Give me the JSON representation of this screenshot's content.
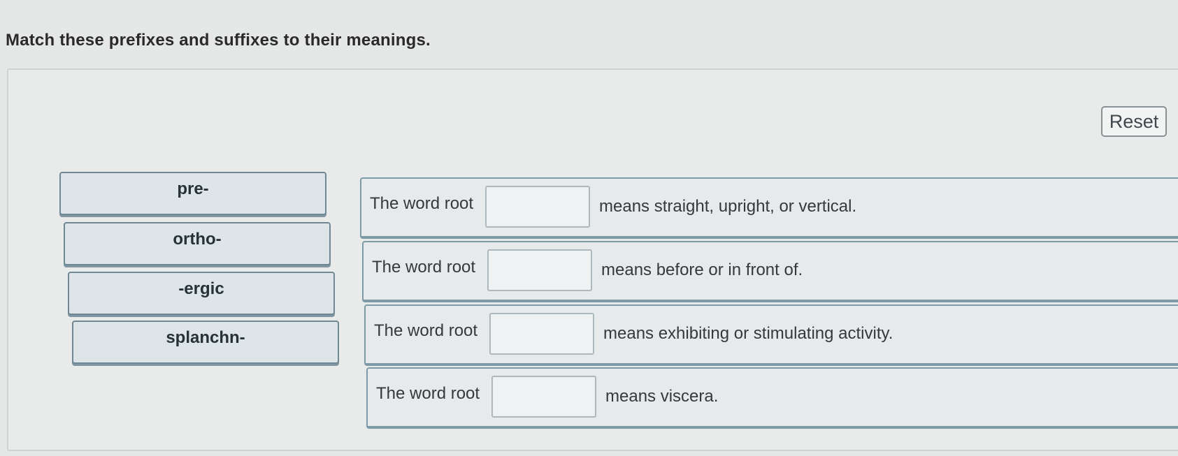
{
  "question": {
    "title": "Match these prefixes and suffixes to their meanings."
  },
  "reset_label": "Reset",
  "tiles": [
    {
      "label": "pre-"
    },
    {
      "label": "ortho-"
    },
    {
      "label": "-ergic"
    },
    {
      "label": "splanchn-"
    }
  ],
  "rows": [
    {
      "prefix_label": "The word root",
      "meaning": "means straight, upright, or vertical."
    },
    {
      "prefix_label": "The word root",
      "meaning": "means before or in front of."
    },
    {
      "prefix_label": "The word root",
      "meaning": "means exhibiting or stimulating activity."
    },
    {
      "prefix_label": "The word root",
      "meaning": "means viscera."
    }
  ]
}
